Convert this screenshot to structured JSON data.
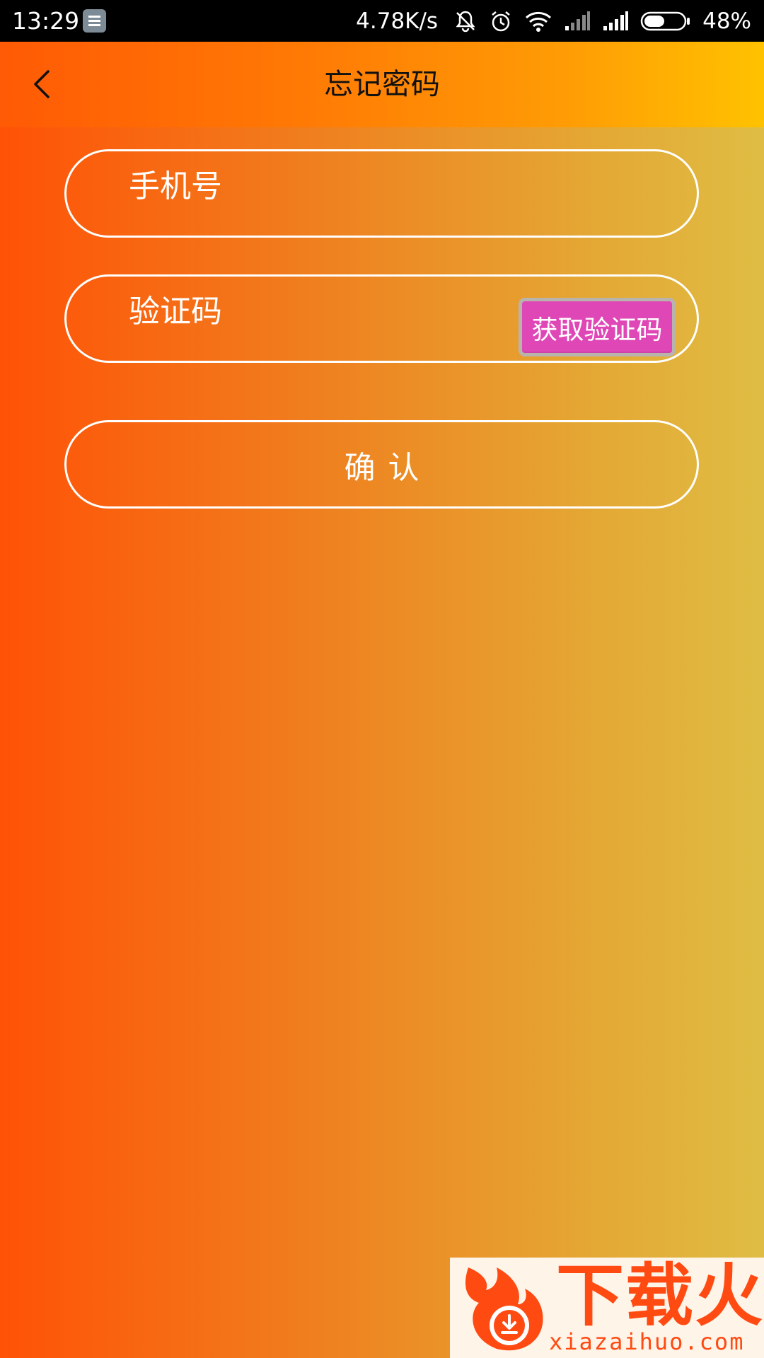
{
  "status_bar": {
    "time": "13:29",
    "network_speed": "4.78K/s",
    "battery": "48%",
    "icons": [
      "notification-icon",
      "mute-icon",
      "alarm-icon",
      "wifi-icon",
      "signal-icon",
      "signal-icon",
      "battery-icon"
    ]
  },
  "header": {
    "title": "忘记密码",
    "back_icon": "chevron-left-icon"
  },
  "form": {
    "phone_placeholder": "手机号",
    "code_placeholder": "验证码",
    "get_code_label": "获取验证码",
    "confirm_label": "确认"
  },
  "watermark": {
    "brand": "下载火",
    "domain": "xiazaihuo.com"
  },
  "colors": {
    "accent_orange": "#ff5a05",
    "accent_yellow": "#ffc200",
    "get_code_bg": "#e047b6"
  }
}
